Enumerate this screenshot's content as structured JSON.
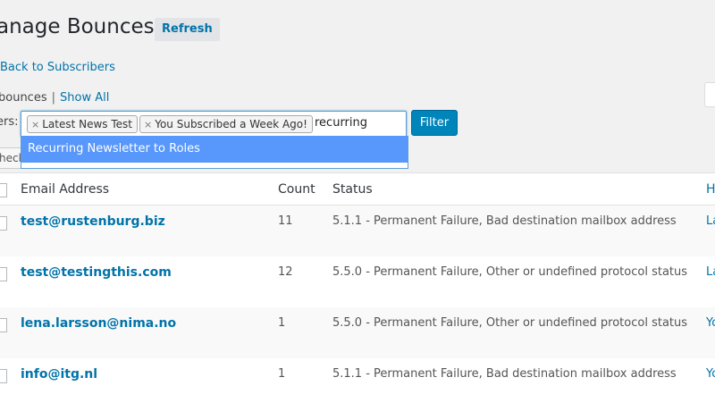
{
  "page": {
    "title": "anage Bounces",
    "refresh_label": "Refresh",
    "back_link": "Back to Subscribers",
    "views": {
      "current": "bounces",
      "separator": "|",
      "show_all": "Show All"
    }
  },
  "filter": {
    "label": "ers:",
    "tags": [
      "Latest News Test",
      "You Subscribed a Week Ago!"
    ],
    "remove_glyph": "×",
    "typed_text": "recurring",
    "button_label": "Filter",
    "suggestions": [
      "Recurring Newsletter to Roles"
    ]
  },
  "bulk": {
    "partial_label": "heck"
  },
  "table": {
    "headers": {
      "email": "Email Address",
      "count": "Count",
      "status": "Status",
      "edge": "H"
    },
    "rows": [
      {
        "email": "test@rustenburg.biz",
        "count": "11",
        "status": "5.1.1 - Permanent Failure, Bad destination mailbox address",
        "edge": "La"
      },
      {
        "email": "test@testingthis.com",
        "count": "12",
        "status": "5.5.0 - Permanent Failure, Other or undefined protocol status",
        "edge": "La"
      },
      {
        "email": "lena.larsson@nima.no",
        "count": "1",
        "status": "5.5.0 - Permanent Failure, Other or undefined protocol status",
        "edge": "Yo"
      },
      {
        "email": "info@itg.nl",
        "count": "1",
        "status": "5.1.1 - Permanent Failure, Bad destination mailbox address",
        "edge": "Yo"
      }
    ]
  },
  "colors": {
    "link": "#0073aa",
    "primary_button": "#0085ba",
    "highlight": "#5897fb"
  }
}
